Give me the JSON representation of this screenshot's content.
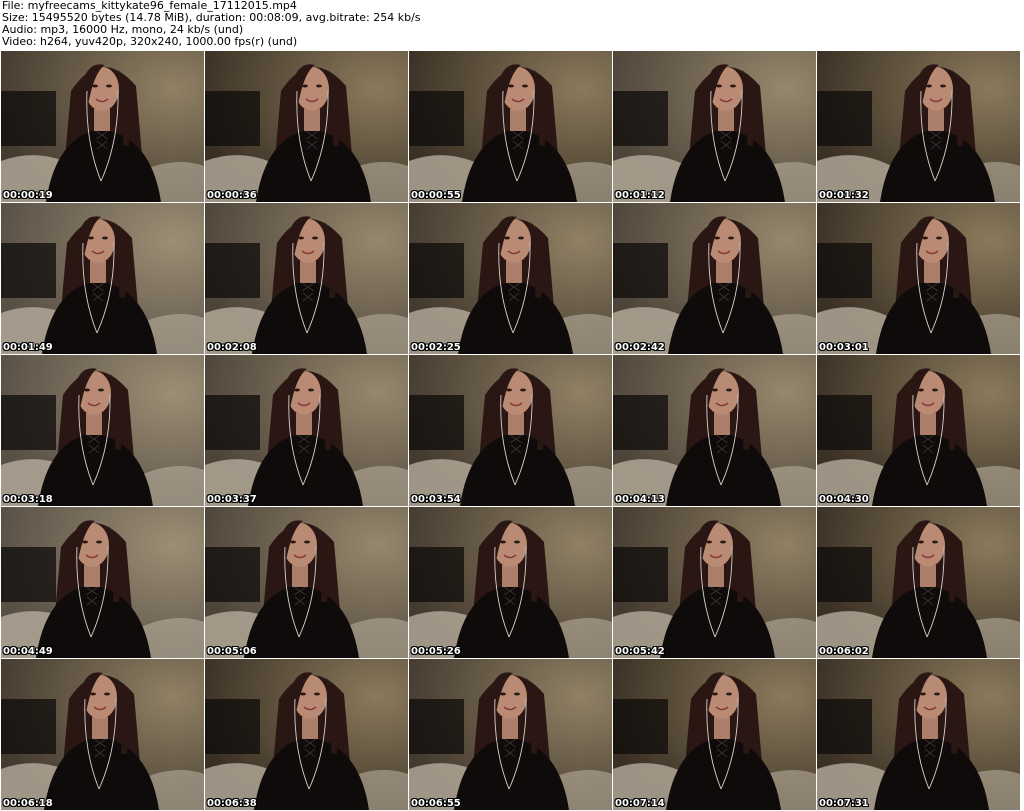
{
  "header": {
    "file": "File: myfreecams_kittykate96_female_17112015.mp4",
    "size": "Size: 15495520 bytes (14.78 MiB), duration: 00:08:09, avg.bitrate: 254 kb/s",
    "audio": "Audio: mp3, 16000 Hz, mono, 24 kb/s (und)",
    "video": "Video: h264, yuv420p, 320x240, 1000.00 fps(r) (und)"
  },
  "colors": {
    "wall": "#8a7a5c",
    "wall_shadow": "#3a3024",
    "dark": "#0e0b0a",
    "hair": "#2a1612",
    "skin": "#b98a74",
    "cable": "#d8d4cc",
    "bedding": "#b7ad9c"
  },
  "frames": [
    {
      "time": "00:00:19"
    },
    {
      "time": "00:00:36"
    },
    {
      "time": "00:00:55"
    },
    {
      "time": "00:01:12"
    },
    {
      "time": "00:01:32"
    },
    {
      "time": "00:01:49"
    },
    {
      "time": "00:02:08"
    },
    {
      "time": "00:02:25"
    },
    {
      "time": "00:02:42"
    },
    {
      "time": "00:03:01"
    },
    {
      "time": "00:03:18"
    },
    {
      "time": "00:03:37"
    },
    {
      "time": "00:03:54"
    },
    {
      "time": "00:04:13"
    },
    {
      "time": "00:04:30"
    },
    {
      "time": "00:04:49"
    },
    {
      "time": "00:05:06"
    },
    {
      "time": "00:05:26"
    },
    {
      "time": "00:05:42"
    },
    {
      "time": "00:06:02"
    },
    {
      "time": "00:06:18"
    },
    {
      "time": "00:06:38"
    },
    {
      "time": "00:06:55"
    },
    {
      "time": "00:07:14"
    },
    {
      "time": "00:07:31"
    }
  ]
}
